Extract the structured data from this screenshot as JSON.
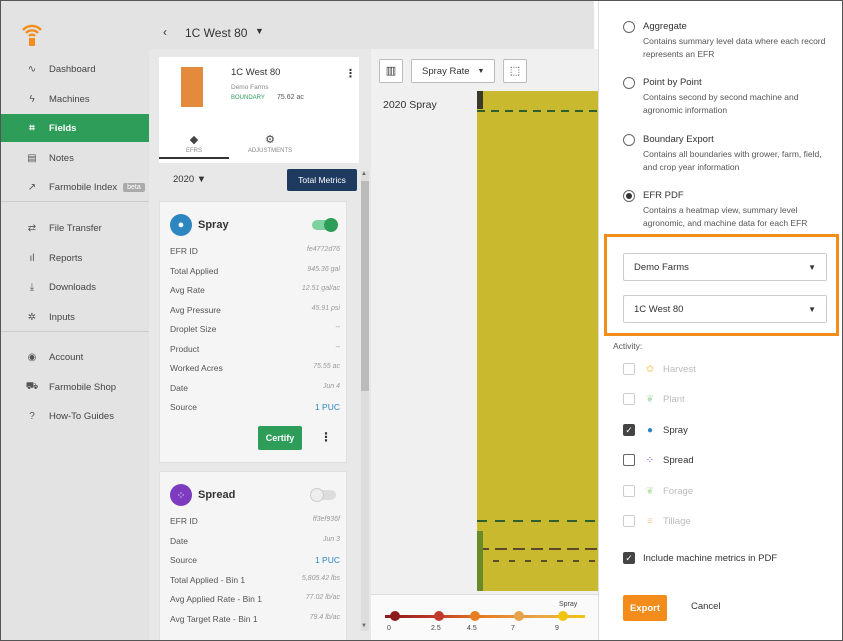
{
  "sidebar": {
    "items": [
      {
        "label": "Dashboard",
        "icon": "pulse-icon"
      },
      {
        "label": "Machines",
        "icon": "lightning-icon"
      },
      {
        "label": "Fields",
        "icon": "field-icon",
        "active": true
      },
      {
        "label": "Notes",
        "icon": "notes-icon"
      },
      {
        "label": "Farmobile Index",
        "icon": "trend-icon",
        "badge": "beta"
      },
      {
        "label": "File Transfer",
        "icon": "transfer-icon"
      },
      {
        "label": "Reports",
        "icon": "bar-chart-icon"
      },
      {
        "label": "Downloads",
        "icon": "download-icon"
      },
      {
        "label": "Inputs",
        "icon": "inputs-icon"
      },
      {
        "label": "Account",
        "icon": "account-icon"
      },
      {
        "label": "Farmobile Shop",
        "icon": "cart-icon"
      },
      {
        "label": "How-To Guides",
        "icon": "help-icon"
      }
    ]
  },
  "header": {
    "back": "‹",
    "field_title": "1C West 80",
    "caret": "▼"
  },
  "field_card": {
    "name": "1C West 80",
    "farm": "Demo Farms",
    "boundary_label": "BOUNDARY",
    "acres": "75.62 ac",
    "menu": "⋮"
  },
  "tabs": {
    "efrs": "EFRS",
    "adjustments": "ADJUSTMENTS"
  },
  "export_button": "Export",
  "year_select": "2020 ▼",
  "total_metrics_button": "Total Metrics",
  "spray_card": {
    "title": "Spray",
    "rows": [
      {
        "k": "EFR ID",
        "v": "fe4772d76"
      },
      {
        "k": "Total Applied",
        "v": "945.36 gal"
      },
      {
        "k": "Avg Rate",
        "v": "12.51 gal/ac"
      },
      {
        "k": "Avg Pressure",
        "v": "45.91 psi"
      },
      {
        "k": "Droplet Size",
        "v": "--"
      },
      {
        "k": "Product",
        "v": "--"
      },
      {
        "k": "Worked Acres",
        "v": "75.55 ac"
      },
      {
        "k": "Date",
        "v": "Jun 4"
      },
      {
        "k": "Source",
        "v": "1 PUC"
      }
    ],
    "certify": "Certify",
    "menu": "⋮"
  },
  "spread_card": {
    "title": "Spread",
    "rows": [
      {
        "k": "EFR ID",
        "v": "ff3ef936f"
      },
      {
        "k": "Date",
        "v": "Jun 3"
      },
      {
        "k": "Source",
        "v": "1 PUC"
      },
      {
        "k": "Total Applied - Bin 1",
        "v": "5,805.42 lbs"
      },
      {
        "k": "Avg Applied Rate - Bin 1",
        "v": "77.02 lb/ac"
      },
      {
        "k": "Avg Target Rate - Bin 1",
        "v": "79.4 lb/ac"
      }
    ]
  },
  "map": {
    "layer_select": "Spray Rate",
    "label": "2020 Spray",
    "layer_color": "#c9b92e",
    "legend_title": "Spray",
    "legend_ticks": [
      "0",
      "2.5",
      "4.5",
      "7",
      "9"
    ]
  },
  "export_panel": {
    "options": [
      {
        "title": "Aggregate",
        "desc": "Contains summary level data where each record represents an EFR",
        "checked": false
      },
      {
        "title": "Point by Point",
        "desc": "Contains second by second machine and agronomic information",
        "checked": false
      },
      {
        "title": "Boundary Export",
        "desc": "Contains all boundaries with grower, farm, field, and crop year information",
        "checked": false
      },
      {
        "title": "EFR PDF",
        "desc": "Contains a heatmap view, summary level agronomic, and machine data for each EFR",
        "checked": true
      }
    ],
    "farm_select": "Demo Farms",
    "field_select": "1C West 80",
    "activity_label": "Activity:",
    "activities": [
      {
        "label": "Harvest",
        "icon": "harvest-icon",
        "glyph": "✿",
        "color": "#f2c14e",
        "checked": false,
        "disabled": true
      },
      {
        "label": "Plant",
        "icon": "plant-icon",
        "glyph": "❦",
        "color": "#7bc67b",
        "checked": false,
        "disabled": true
      },
      {
        "label": "Spray",
        "icon": "spray-icon",
        "glyph": "●",
        "color": "#2e86c1",
        "checked": true,
        "disabled": false
      },
      {
        "label": "Spread",
        "icon": "spread-icon",
        "glyph": "⁘",
        "color": "#7d3cbf",
        "checked": false,
        "disabled": false
      },
      {
        "label": "Forage",
        "icon": "forage-icon",
        "glyph": "❦",
        "color": "#8bcf6b",
        "checked": false,
        "disabled": true
      },
      {
        "label": "Tillage",
        "icon": "tillage-icon",
        "glyph": "≡",
        "color": "#f5a25d",
        "checked": false,
        "disabled": true
      }
    ],
    "include_metrics": "Include machine metrics in PDF",
    "export": "Export",
    "cancel": "Cancel"
  },
  "colors": {
    "accent_green": "#2e9d5a",
    "accent_orange": "#f28c1b",
    "navy": "#1f3a5f"
  }
}
